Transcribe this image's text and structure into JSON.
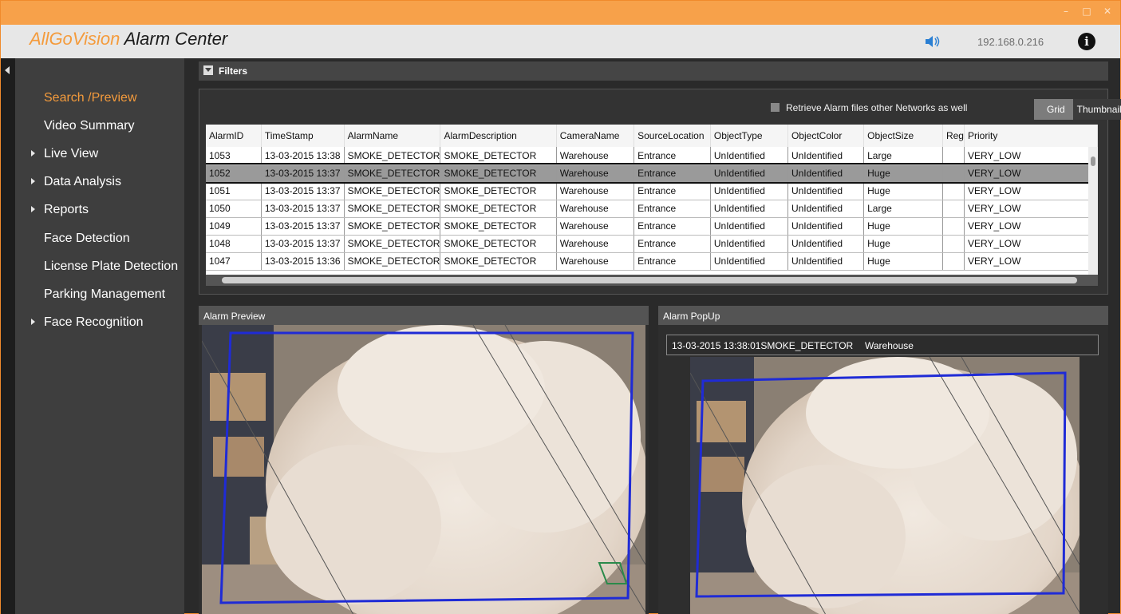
{
  "window": {
    "controls": [
      "–",
      "□",
      "✕"
    ]
  },
  "app": {
    "brand_part1": "AllGoVision",
    "brand_part2": "Alarm Center",
    "ip": "192.168.0.216",
    "info_label": "i"
  },
  "sidebar": {
    "items": [
      {
        "label": "Search /Preview",
        "active": true,
        "expandable": false
      },
      {
        "label": "Video Summary",
        "active": false,
        "expandable": false
      },
      {
        "label": "Live View",
        "active": false,
        "expandable": true
      },
      {
        "label": "Data Analysis",
        "active": false,
        "expandable": true
      },
      {
        "label": "Reports",
        "active": false,
        "expandable": true
      },
      {
        "label": "Face Detection",
        "active": false,
        "expandable": false
      },
      {
        "label": "License Plate Detection",
        "active": false,
        "expandable": false
      },
      {
        "label": "Parking Management",
        "active": false,
        "expandable": false
      },
      {
        "label": "Face Recognition",
        "active": false,
        "expandable": true
      }
    ]
  },
  "filters": {
    "label": "Filters"
  },
  "grid": {
    "retrieve_label": "Retrieve Alarm files other Networks as well",
    "view_grid": "Grid",
    "view_thumbnail": "Thumbnail",
    "columns": [
      "AlarmID",
      "TimeStamp",
      "AlarmName",
      "AlarmDescription",
      "CameraName",
      "SourceLocation",
      "ObjectType",
      "ObjectColor",
      "ObjectSize",
      "Reg",
      "Priority"
    ],
    "rows": [
      [
        "1053",
        "13-03-2015 13:38",
        "SMOKE_DETECTOR",
        "SMOKE_DETECTOR",
        "Warehouse",
        "Entrance",
        "UnIdentified",
        "UnIdentified",
        "Large",
        "",
        "VERY_LOW"
      ],
      [
        "1052",
        "13-03-2015 13:37",
        "SMOKE_DETECTOR",
        "SMOKE_DETECTOR",
        "Warehouse",
        "Entrance",
        "UnIdentified",
        "UnIdentified",
        "Huge",
        "",
        "VERY_LOW"
      ],
      [
        "1051",
        "13-03-2015 13:37",
        "SMOKE_DETECTOR",
        "SMOKE_DETECTOR",
        "Warehouse",
        "Entrance",
        "UnIdentified",
        "UnIdentified",
        "Huge",
        "",
        "VERY_LOW"
      ],
      [
        "1050",
        "13-03-2015 13:37",
        "SMOKE_DETECTOR",
        "SMOKE_DETECTOR",
        "Warehouse",
        "Entrance",
        "UnIdentified",
        "UnIdentified",
        "Large",
        "",
        "VERY_LOW"
      ],
      [
        "1049",
        "13-03-2015 13:37",
        "SMOKE_DETECTOR",
        "SMOKE_DETECTOR",
        "Warehouse",
        "Entrance",
        "UnIdentified",
        "UnIdentified",
        "Huge",
        "",
        "VERY_LOW"
      ],
      [
        "1048",
        "13-03-2015 13:37",
        "SMOKE_DETECTOR",
        "SMOKE_DETECTOR",
        "Warehouse",
        "Entrance",
        "UnIdentified",
        "UnIdentified",
        "Huge",
        "",
        "VERY_LOW"
      ],
      [
        "1047",
        "13-03-2015 13:36",
        "SMOKE_DETECTOR",
        "SMOKE_DETECTOR",
        "Warehouse",
        "Entrance",
        "UnIdentified",
        "UnIdentified",
        "Huge",
        "",
        "VERY_LOW"
      ]
    ],
    "selected_row": 1
  },
  "alarm_preview": {
    "title": "Alarm Preview"
  },
  "alarm_popup": {
    "title": "Alarm PopUp",
    "timestamp": "13-03-2015 13:38:01SMOKE_DETECTOR",
    "camera": "Warehouse"
  },
  "colors": {
    "accent": "#f49b3c",
    "detection_box": "#1f2bd6",
    "smoke": "#e8ddd2"
  }
}
